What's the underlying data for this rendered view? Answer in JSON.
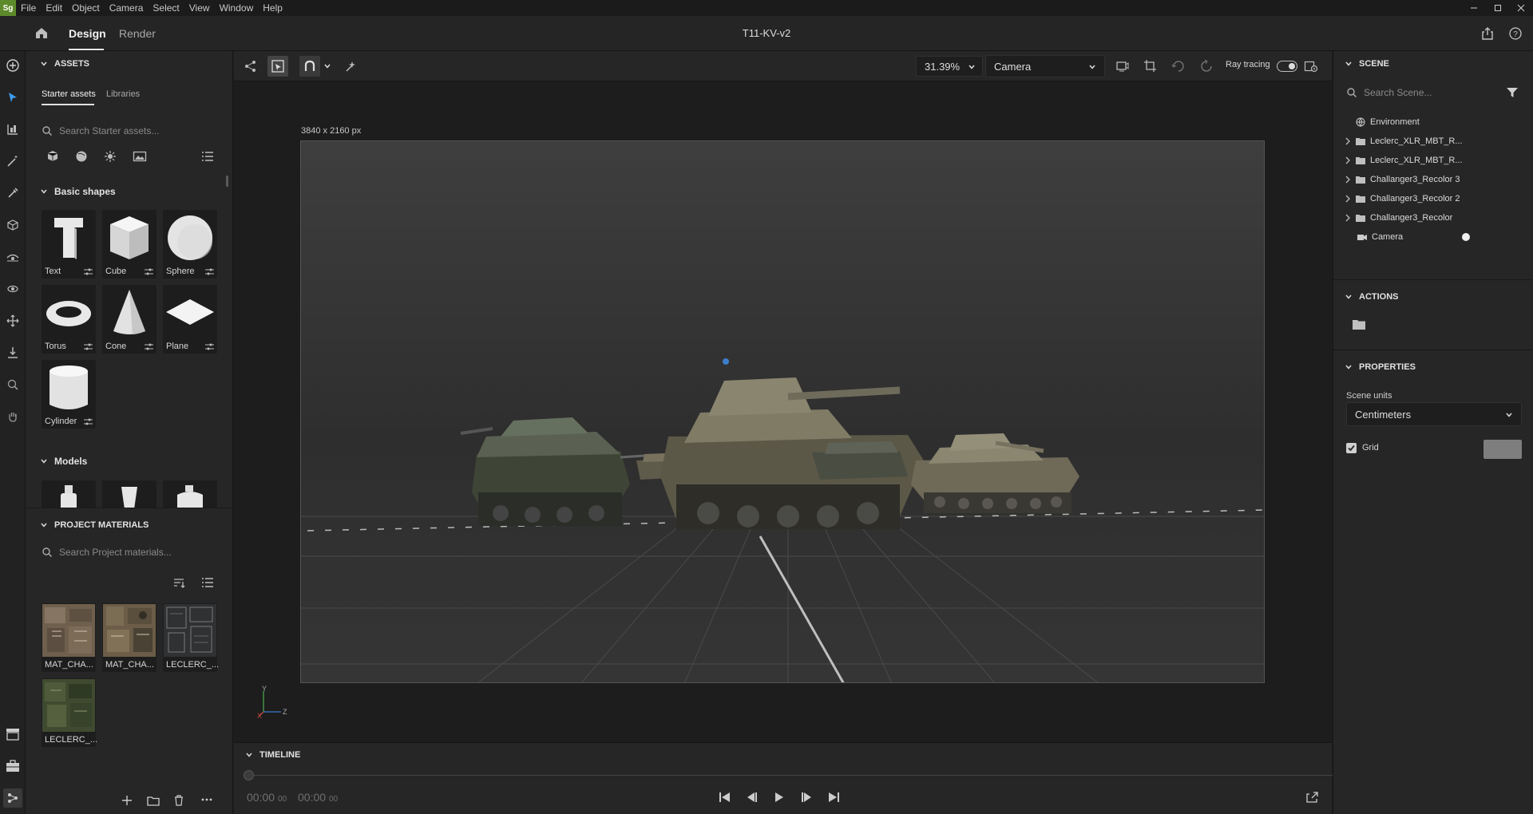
{
  "app": {
    "logo": "Sg"
  },
  "menu": [
    "File",
    "Edit",
    "Object",
    "Camera",
    "Select",
    "View",
    "Window",
    "Help"
  ],
  "topbar": {
    "tabs": [
      "Design",
      "Render"
    ],
    "active_tab": "Design",
    "title": "T11-KV-v2"
  },
  "assets": {
    "header": "ASSETS",
    "tabs": [
      "Starter assets",
      "Libraries"
    ],
    "search_placeholder": "Search Starter assets...",
    "basic_shapes_label": "Basic shapes",
    "shapes": [
      "Text",
      "Cube",
      "Sphere",
      "Torus",
      "Cone",
      "Plane",
      "Cylinder"
    ],
    "models_label": "Models"
  },
  "materials": {
    "header": "PROJECT MATERIALS",
    "search_placeholder": "Search Project materials...",
    "items": [
      "MAT_CHA...",
      "MAT_CHA...",
      "LECLERC_...",
      "LECLERC_..."
    ]
  },
  "viewport": {
    "zoom": "31.39%",
    "camera": "Camera",
    "ray_tracing_label": "Ray tracing",
    "canvas_size": "3840 x 2160 px",
    "axis": {
      "y": "Y",
      "x": "X",
      "z": "Z"
    }
  },
  "timeline": {
    "header": "TIMELINE",
    "time_current": "00:00",
    "time_current_frames": "00",
    "time_total": "00:00",
    "time_total_frames": "00"
  },
  "scene": {
    "header": "SCENE",
    "search_placeholder": "Search Scene...",
    "items": [
      {
        "label": "Environment",
        "icon": "globe-icon"
      },
      {
        "label": "Leclerc_XLR_MBT_R...",
        "icon": "folder-icon"
      },
      {
        "label": "Leclerc_XLR_MBT_R...",
        "icon": "folder-icon"
      },
      {
        "label": "Challanger3_Recolor 3",
        "icon": "folder-icon"
      },
      {
        "label": "Challanger3_Recolor 2",
        "icon": "folder-icon"
      },
      {
        "label": "Challanger3_Recolor",
        "icon": "folder-icon"
      },
      {
        "label": "Camera",
        "icon": "camera-icon"
      }
    ]
  },
  "actions": {
    "header": "ACTIONS"
  },
  "properties": {
    "header": "PROPERTIES",
    "scene_units_label": "Scene units",
    "scene_units_value": "Centimeters",
    "grid_label": "Grid",
    "grid_checked": true
  }
}
